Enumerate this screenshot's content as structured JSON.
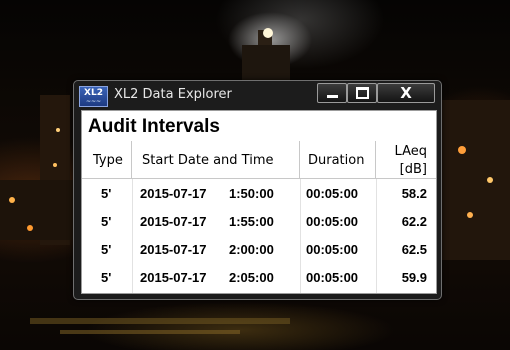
{
  "window": {
    "title": "XL2 Data Explorer",
    "logo_text": "XL2",
    "logo_sub": "~~~",
    "minimize_label": "",
    "maximize_label": "",
    "close_label": "X"
  },
  "heading": "Audit Intervals",
  "table": {
    "headers": {
      "type": "Type",
      "start": "Start Date and Time",
      "duration": "Duration",
      "laeq_line1": "LAeq",
      "laeq_line2": "[dB]"
    },
    "rows": [
      {
        "type": "5'",
        "date": "2015-07-17",
        "time": "1:50:00",
        "duration": "00:05:00",
        "laeq": "58.2"
      },
      {
        "type": "5'",
        "date": "2015-07-17",
        "time": "1:55:00",
        "duration": "00:05:00",
        "laeq": "62.2"
      },
      {
        "type": "5'",
        "date": "2015-07-17",
        "time": "2:00:00",
        "duration": "00:05:00",
        "laeq": "62.5"
      },
      {
        "type": "5'",
        "date": "2015-07-17",
        "time": "2:05:00",
        "duration": "00:05:00",
        "laeq": "59.9"
      }
    ]
  }
}
